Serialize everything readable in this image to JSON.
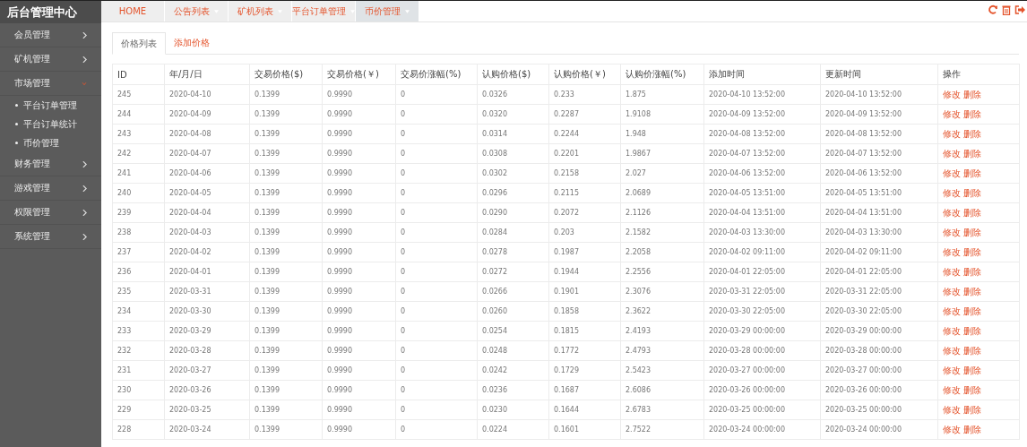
{
  "brand": "后台管理中心",
  "sidebar": {
    "items": [
      {
        "label": "会员管理",
        "expanded": false
      },
      {
        "label": "矿机管理",
        "expanded": false
      },
      {
        "label": "市场管理",
        "expanded": true,
        "children": [
          {
            "label": "平台订单管理"
          },
          {
            "label": "平台订单统计"
          },
          {
            "label": "币价管理"
          }
        ]
      },
      {
        "label": "财务管理",
        "expanded": false
      },
      {
        "label": "游戏管理",
        "expanded": false
      },
      {
        "label": "权限管理",
        "expanded": false
      },
      {
        "label": "系统管理",
        "expanded": false
      }
    ]
  },
  "page_tabs": [
    {
      "label": "HOME",
      "selected": false,
      "closable": false
    },
    {
      "label": "公告列表",
      "selected": false,
      "closable": true
    },
    {
      "label": "矿机列表",
      "selected": false,
      "closable": true
    },
    {
      "label": "平台订单管理",
      "selected": false,
      "closable": true
    },
    {
      "label": "币价管理",
      "selected": true,
      "closable": true
    }
  ],
  "sub_tabs": [
    {
      "label": "价格列表",
      "selected": true
    },
    {
      "label": "添加价格",
      "selected": false
    }
  ],
  "table": {
    "columns": [
      "ID",
      "年/月/日",
      "交易价格($)",
      "交易价格(￥)",
      "交易价涨幅(%)",
      "认购价格($)",
      "认购价格(￥)",
      "认购价涨幅(%)",
      "添加时间",
      "更新时间",
      "操作"
    ],
    "rows": [
      {
        "cells": [
          "245",
          "2020-04-10",
          "0.1399",
          "0.9990",
          "0",
          "0.0326",
          "0.233",
          "1.875",
          "2020-04-10 13:52:00",
          "2020-04-10 13:52:00"
        ],
        "actions": [
          "修改",
          "删除"
        ]
      },
      {
        "cells": [
          "244",
          "2020-04-09",
          "0.1399",
          "0.9990",
          "0",
          "0.0320",
          "0.2287",
          "1.9108",
          "2020-04-09 13:52:00",
          "2020-04-09 13:52:00"
        ],
        "actions": [
          "修改",
          "删除"
        ]
      },
      {
        "cells": [
          "243",
          "2020-04-08",
          "0.1399",
          "0.9990",
          "0",
          "0.0314",
          "0.2244",
          "1.948",
          "2020-04-08 13:52:00",
          "2020-04-08 13:52:00"
        ],
        "actions": [
          "修改",
          "删除"
        ]
      },
      {
        "cells": [
          "242",
          "2020-04-07",
          "0.1399",
          "0.9990",
          "0",
          "0.0308",
          "0.2201",
          "1.9867",
          "2020-04-07 13:52:00",
          "2020-04-07 13:52:00"
        ],
        "actions": [
          "修改",
          "删除"
        ]
      },
      {
        "cells": [
          "241",
          "2020-04-06",
          "0.1399",
          "0.9990",
          "0",
          "0.0302",
          "0.2158",
          "2.027",
          "2020-04-06 13:52:00",
          "2020-04-06 13:52:00"
        ],
        "actions": [
          "修改",
          "删除"
        ]
      },
      {
        "cells": [
          "240",
          "2020-04-05",
          "0.1399",
          "0.9990",
          "0",
          "0.0296",
          "0.2115",
          "2.0689",
          "2020-04-05 13:51:00",
          "2020-04-05 13:51:00"
        ],
        "actions": [
          "修改",
          "删除"
        ]
      },
      {
        "cells": [
          "239",
          "2020-04-04",
          "0.1399",
          "0.9990",
          "0",
          "0.0290",
          "0.2072",
          "2.1126",
          "2020-04-04 13:51:00",
          "2020-04-04 13:51:00"
        ],
        "actions": [
          "修改",
          "删除"
        ]
      },
      {
        "cells": [
          "238",
          "2020-04-03",
          "0.1399",
          "0.9990",
          "0",
          "0.0284",
          "0.203",
          "2.1582",
          "2020-04-03 13:30:00",
          "2020-04-03 13:30:00"
        ],
        "actions": [
          "修改",
          "删除"
        ]
      },
      {
        "cells": [
          "237",
          "2020-04-02",
          "0.1399",
          "0.9990",
          "0",
          "0.0278",
          "0.1987",
          "2.2058",
          "2020-04-02 09:11:00",
          "2020-04-02 09:11:00"
        ],
        "actions": [
          "修改",
          "删除"
        ]
      },
      {
        "cells": [
          "236",
          "2020-04-01",
          "0.1399",
          "0.9990",
          "0",
          "0.0272",
          "0.1944",
          "2.2556",
          "2020-04-01 22:05:00",
          "2020-04-01 22:05:00"
        ],
        "actions": [
          "修改",
          "删除"
        ]
      },
      {
        "cells": [
          "235",
          "2020-03-31",
          "0.1399",
          "0.9990",
          "0",
          "0.0266",
          "0.1901",
          "2.3076",
          "2020-03-31 22:05:00",
          "2020-03-31 22:05:00"
        ],
        "actions": [
          "修改",
          "删除"
        ]
      },
      {
        "cells": [
          "234",
          "2020-03-30",
          "0.1399",
          "0.9990",
          "0",
          "0.0260",
          "0.1858",
          "2.3622",
          "2020-03-30 22:05:00",
          "2020-03-30 22:05:00"
        ],
        "actions": [
          "修改",
          "删除"
        ]
      },
      {
        "cells": [
          "233",
          "2020-03-29",
          "0.1399",
          "0.9990",
          "0",
          "0.0254",
          "0.1815",
          "2.4193",
          "2020-03-29 00:00:00",
          "2020-03-29 00:00:00"
        ],
        "actions": [
          "修改",
          "删除"
        ]
      },
      {
        "cells": [
          "232",
          "2020-03-28",
          "0.1399",
          "0.9990",
          "0",
          "0.0248",
          "0.1772",
          "2.4793",
          "2020-03-28 00:00:00",
          "2020-03-28 00:00:00"
        ],
        "actions": [
          "修改",
          "删除"
        ]
      },
      {
        "cells": [
          "231",
          "2020-03-27",
          "0.1399",
          "0.9990",
          "0",
          "0.0242",
          "0.1729",
          "2.5423",
          "2020-03-27 00:00:00",
          "2020-03-27 00:00:00"
        ],
        "actions": [
          "修改",
          "删除"
        ]
      },
      {
        "cells": [
          "230",
          "2020-03-26",
          "0.1399",
          "0.9990",
          "0",
          "0.0236",
          "0.1687",
          "2.6086",
          "2020-03-26 00:00:00",
          "2020-03-26 00:00:00"
        ],
        "actions": [
          "修改",
          "删除"
        ]
      },
      {
        "cells": [
          "229",
          "2020-03-25",
          "0.1399",
          "0.9990",
          "0",
          "0.0230",
          "0.1644",
          "2.6783",
          "2020-03-25 00:00:00",
          "2020-03-25 00:00:00"
        ],
        "actions": [
          "修改",
          "删除"
        ]
      },
      {
        "cells": [
          "228",
          "2020-03-24",
          "0.1399",
          "0.9990",
          "0",
          "0.0224",
          "0.1601",
          "2.7522",
          "2020-03-24 00:00:00",
          "2020-03-24 00:00:00"
        ],
        "actions": [
          "修改",
          "删除"
        ]
      }
    ]
  }
}
